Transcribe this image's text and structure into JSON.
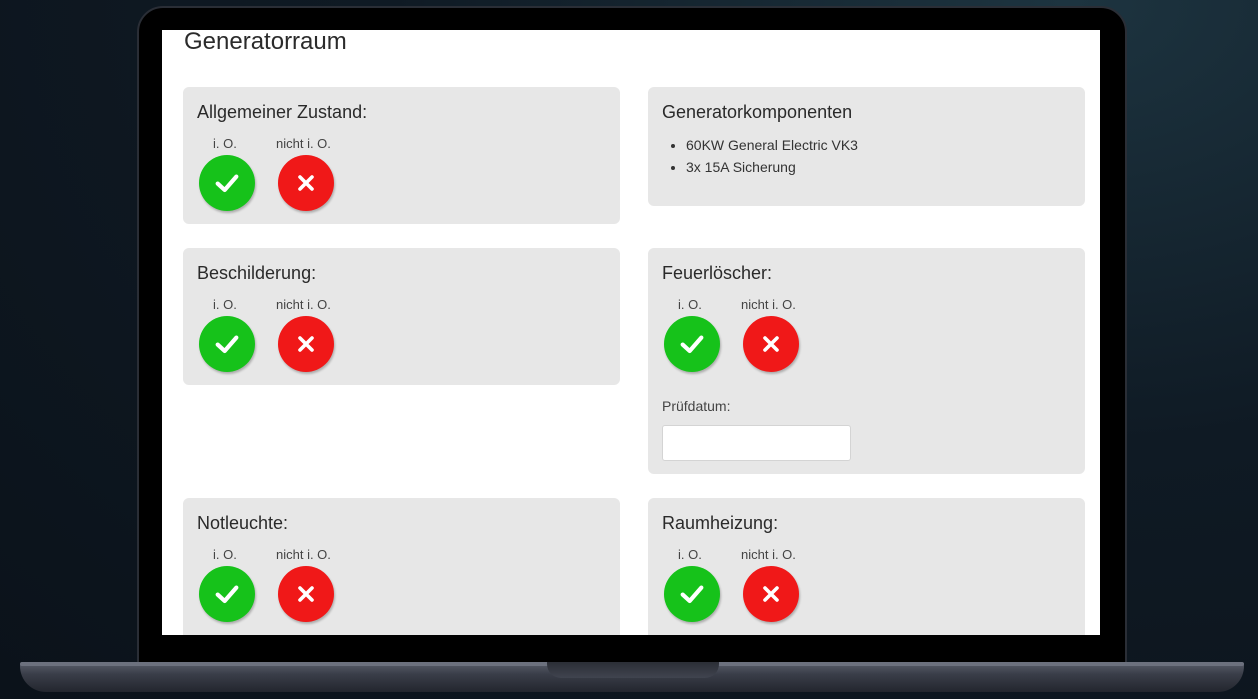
{
  "page": {
    "title": "Generatorraum"
  },
  "labels": {
    "ok": "i. O.",
    "not_ok": "nicht i. O."
  },
  "cards": {
    "zustand": {
      "title": "Allgemeiner Zustand:"
    },
    "komponenten": {
      "title": "Generatorkomponenten",
      "items": [
        "60KW General Electric VK3",
        "3x 15A Sicherung"
      ]
    },
    "beschilderung": {
      "title": "Beschilderung:"
    },
    "feuerloescher": {
      "title": "Feuerlöscher:",
      "date_label": "Prüfdatum:",
      "date_value": ""
    },
    "notleuchte": {
      "title": "Notleuchte:"
    },
    "raumheizung": {
      "title": "Raumheizung:"
    }
  },
  "colors": {
    "ok": "#16c21a",
    "not_ok": "#f01818",
    "card_bg": "#e7e7e7"
  },
  "icons": {
    "ok": "check-icon",
    "not_ok": "x-icon"
  }
}
